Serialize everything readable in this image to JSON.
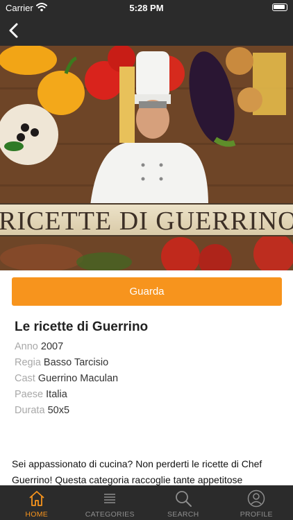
{
  "status_bar": {
    "carrier": "Carrier",
    "time": "5:28 PM"
  },
  "hero": {
    "banner_text": "RICETTE DI GUERRINO"
  },
  "watch_button": {
    "label": "Guarda"
  },
  "show": {
    "title": "Le ricette di Guerrino",
    "details": [
      {
        "label": "Anno",
        "value": "2007"
      },
      {
        "label": "Regia",
        "value": "Basso Tarcisio"
      },
      {
        "label": "Cast",
        "value": "Guerrino Maculan"
      },
      {
        "label": "Paese",
        "value": "Italia"
      },
      {
        "label": "Durata",
        "value": "50x5"
      }
    ],
    "description": "Sei appassionato di cucina? Non perderti le ricette di Chef Guerrino! Questa categoria raccoglie tante appetitose"
  },
  "tab_bar": {
    "tabs": [
      {
        "label": "HOME",
        "icon": "home-icon",
        "active": true
      },
      {
        "label": "CATEGORIES",
        "icon": "list-icon",
        "active": false
      },
      {
        "label": "SEARCH",
        "icon": "search-icon",
        "active": false
      },
      {
        "label": "PROFILE",
        "icon": "profile-icon",
        "active": false
      }
    ]
  },
  "colors": {
    "accent": "#f7941d",
    "bar": "#2b2b2b",
    "muted": "#a8a8a8"
  }
}
